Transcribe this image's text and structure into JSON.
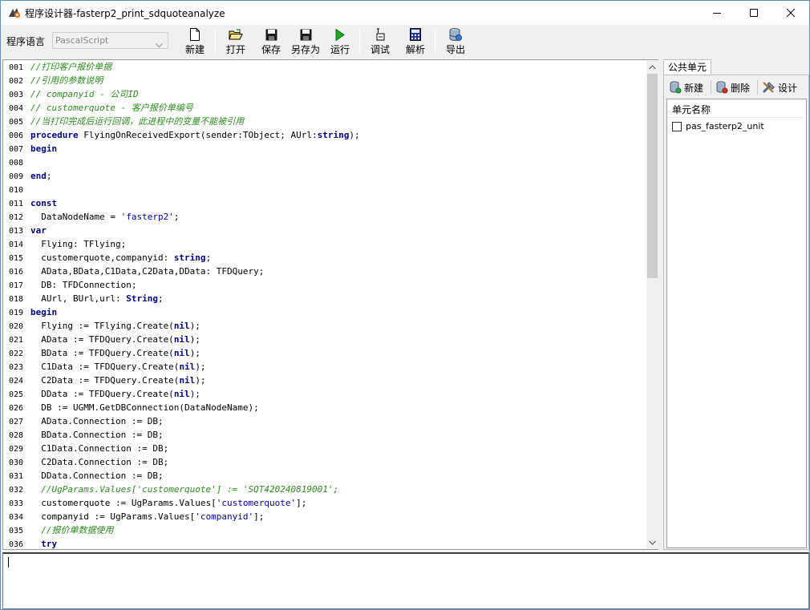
{
  "window": {
    "title": "程序设计器-fasterp2_print_sdquoteanalyze"
  },
  "toolbar": {
    "lang_label": "程序语言",
    "lang_value": "PascalScript",
    "buttons": {
      "new": "新建",
      "open": "打开",
      "save": "保存",
      "save_as": "另存为",
      "run": "运行",
      "debug": "调试",
      "parse": "解析",
      "export": "导出"
    }
  },
  "editor": {
    "lines": [
      {
        "n": "001",
        "text": "//打印客户报价单据",
        "kind": "comment"
      },
      {
        "n": "002",
        "text": "//引用的参数说明",
        "kind": "comment"
      },
      {
        "n": "003",
        "text": "// companyid - 公司ID",
        "kind": "comment"
      },
      {
        "n": "004",
        "text": "// customerquote - 客户报价单编号",
        "kind": "comment"
      },
      {
        "n": "005",
        "text": "//当打印完成后运行回调，此进程中的变量不能被引用",
        "kind": "comment"
      },
      {
        "n": "006",
        "text": "procedure FlyingOnReceivedExport(sender:TObject; AUrl:string);",
        "kind": "proc"
      },
      {
        "n": "007",
        "text": "begin",
        "kind": "keyword"
      },
      {
        "n": "008",
        "text": "",
        "kind": "plain"
      },
      {
        "n": "009",
        "text": "end;",
        "kind": "keyword"
      },
      {
        "n": "010",
        "text": "",
        "kind": "plain"
      },
      {
        "n": "011",
        "text": "const",
        "kind": "keyword"
      },
      {
        "n": "012",
        "text": "  DataNodeName = 'fasterp2';",
        "kind": "const"
      },
      {
        "n": "013",
        "text": "var",
        "kind": "keyword"
      },
      {
        "n": "014",
        "text": "  Flying: TFlying;",
        "kind": "plain"
      },
      {
        "n": "015",
        "text": "  customerquote,companyid: string;",
        "kind": "decl_string"
      },
      {
        "n": "016",
        "text": "  AData,BData,C1Data,C2Data,DData: TFDQuery;",
        "kind": "plain"
      },
      {
        "n": "017",
        "text": "  DB: TFDConnection;",
        "kind": "plain"
      },
      {
        "n": "018",
        "text": "  AUrl, BUrl,url: String;",
        "kind": "decl_string"
      },
      {
        "n": "019",
        "text": "begin",
        "kind": "keyword"
      },
      {
        "n": "020",
        "text": "  Flying := TFlying.Create(nil);",
        "kind": "create"
      },
      {
        "n": "021",
        "text": "  AData := TFDQuery.Create(nil);",
        "kind": "create"
      },
      {
        "n": "022",
        "text": "  BData := TFDQuery.Create(nil);",
        "kind": "create"
      },
      {
        "n": "023",
        "text": "  C1Data := TFDQuery.Create(nil);",
        "kind": "create"
      },
      {
        "n": "024",
        "text": "  C2Data := TFDQuery.Create(nil);",
        "kind": "create"
      },
      {
        "n": "025",
        "text": "  DData := TFDQuery.Create(nil);",
        "kind": "create"
      },
      {
        "n": "026",
        "text": "  DB := UGMM.GetDBConnection(DataNodeName);",
        "kind": "plain"
      },
      {
        "n": "027",
        "text": "  AData.Connection := DB;",
        "kind": "plain"
      },
      {
        "n": "028",
        "text": "  BData.Connection := DB;",
        "kind": "plain"
      },
      {
        "n": "029",
        "text": "  C1Data.Connection := DB;",
        "kind": "plain"
      },
      {
        "n": "030",
        "text": "  C2Data.Connection := DB;",
        "kind": "plain"
      },
      {
        "n": "031",
        "text": "  DData.Connection := DB;",
        "kind": "plain"
      },
      {
        "n": "032",
        "text": "  //UgParams.Values['customerquote'] := 'SQT420240819001';",
        "kind": "comment"
      },
      {
        "n": "033",
        "text": "  customerquote := UgParams.Values['customerquote'];",
        "kind": "param"
      },
      {
        "n": "034",
        "text": "  companyid := UgParams.Values['companyid'];",
        "kind": "param"
      },
      {
        "n": "035",
        "text": "  //报价单数据使用",
        "kind": "comment"
      },
      {
        "n": "036",
        "text": "  try",
        "kind": "keyword"
      }
    ]
  },
  "rpanel": {
    "tab": "公共单元",
    "new": "新建",
    "delete": "删除",
    "design": "设计",
    "list_header": "单元名称",
    "items": [
      "pas_fasterp2_unit"
    ]
  }
}
